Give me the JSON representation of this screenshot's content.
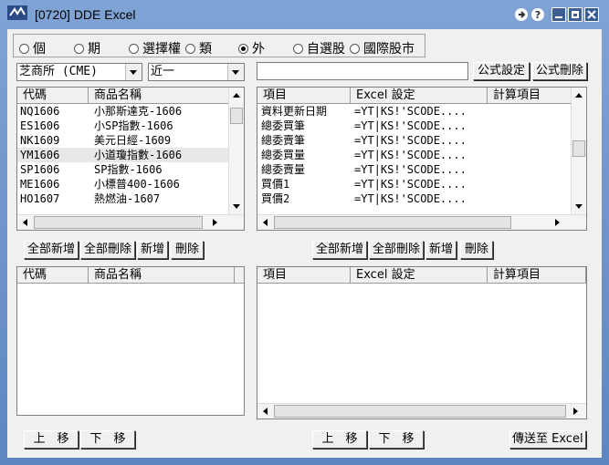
{
  "window": {
    "title": "[0720] DDE Excel"
  },
  "radios": [
    {
      "label": "個",
      "checked": false
    },
    {
      "label": "期",
      "checked": false
    },
    {
      "label": "選擇權",
      "checked": false
    },
    {
      "label": "類",
      "checked": false
    },
    {
      "label": "外",
      "checked": true
    },
    {
      "label": "自選股",
      "checked": false
    },
    {
      "label": "國際股市",
      "checked": false
    }
  ],
  "exchange_combo": {
    "value": "芝商所 (CME)"
  },
  "period_combo": {
    "value": "近一"
  },
  "formula_input": {
    "value": ""
  },
  "buttons": {
    "formula_set": "公式設定",
    "formula_delete": "公式刪除",
    "add_all_left": "全部新增",
    "delete_all_left": "全部刪除",
    "add_left": "新增",
    "delete_left": "刪除",
    "add_all_right": "全部新增",
    "delete_all_right": "全部刪除",
    "add_right": "新增",
    "delete_right": "刪除",
    "move_up_left": "上　移",
    "move_down_left": "下　移",
    "move_up_right": "上　移",
    "move_down_right": "下　移",
    "send_to_excel": "傳送至 Excel"
  },
  "product_list": {
    "columns": [
      "代碼",
      "商品名稱"
    ],
    "rows": [
      [
        "NQ1606",
        "小那斯達克-1606"
      ],
      [
        "ES1606",
        "小SP指數-1606"
      ],
      [
        "NK1609",
        "美元日經-1609"
      ],
      [
        "YM1606",
        "小道瓊指數-1606"
      ],
      [
        "SP1606",
        "SP指數-1606"
      ],
      [
        "ME1606",
        "小標普400-1606"
      ],
      [
        "HO1607",
        "熱燃油-1607"
      ]
    ],
    "selected_index": 3
  },
  "item_list": {
    "columns": [
      "項目",
      "Excel 設定",
      "計算項目"
    ],
    "rows": [
      [
        "資料更新日期",
        "=YT|KS!'SCODE...."
      ],
      [
        "總委買筆",
        "=YT|KS!'SCODE...."
      ],
      [
        "總委賣筆",
        "=YT|KS!'SCODE...."
      ],
      [
        "總委買量",
        "=YT|KS!'SCODE...."
      ],
      [
        "總委賣量",
        "=YT|KS!'SCODE...."
      ],
      [
        "買價1",
        "=YT|KS!'SCODE...."
      ],
      [
        "買價2",
        "=YT|KS!'SCODE...."
      ]
    ]
  },
  "selected_products": {
    "columns": [
      "代碼",
      "商品名稱"
    ]
  },
  "selected_items": {
    "columns": [
      "項目",
      "Excel 設定",
      "計算項目"
    ]
  }
}
